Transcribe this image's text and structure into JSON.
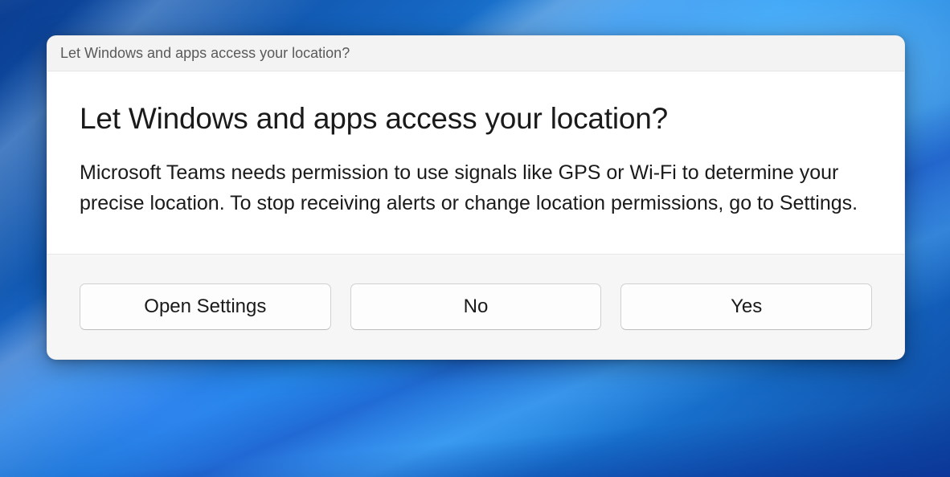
{
  "titlebar": {
    "text": "Let Windows and apps access your location?"
  },
  "content": {
    "heading": "Let Windows and apps access your location?",
    "body": "Microsoft Teams needs permission to use signals like GPS or Wi-Fi to determine your precise location. To stop receiving alerts or change location permissions, go to Settings."
  },
  "buttons": {
    "open_settings": "Open Settings",
    "no": "No",
    "yes": "Yes"
  }
}
